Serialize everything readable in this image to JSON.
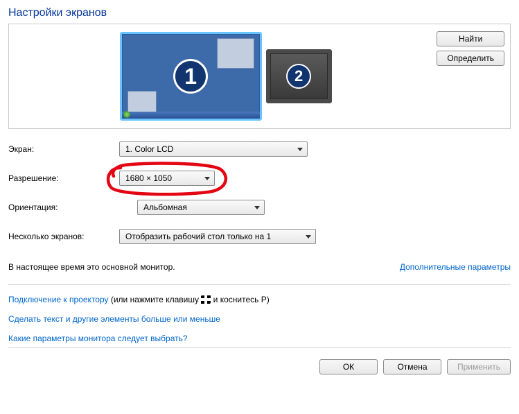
{
  "title": "Настройки экранов",
  "buttons": {
    "find": "Найти",
    "identify": "Определить",
    "ok": "ОК",
    "cancel": "Отмена",
    "apply": "Применить"
  },
  "monitors": {
    "primary_num": "1",
    "secondary_num": "2"
  },
  "labels": {
    "screen": "Экран:",
    "resolution": "Разрешение:",
    "orientation": "Ориентация:",
    "multi": "Несколько экранов:"
  },
  "values": {
    "screen": "1. Color LCD",
    "resolution": "1680 × 1050",
    "orientation": "Альбомная",
    "multi": "Отобразить рабочий стол только на 1"
  },
  "info": "В настоящее время это основной монитор.",
  "adv_link": "Дополнительные параметры",
  "projector": {
    "link": "Подключение к проектору",
    "before": " (или нажмите клавишу ",
    "after": " и коснитесь P)"
  },
  "text_size_link": "Сделать текст и другие элементы больше или меньше",
  "help_link": "Какие параметры монитора следует выбрать?"
}
